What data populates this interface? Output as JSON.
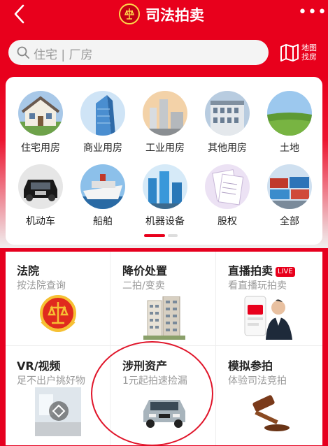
{
  "header": {
    "title": "司法拍卖",
    "back_icon": "chevron-left-icon",
    "more_label": "•••"
  },
  "search": {
    "placeholder": "住宅 | 厂房"
  },
  "map": {
    "label": "地图找房"
  },
  "categories": [
    {
      "label": "住宅用房"
    },
    {
      "label": "商业用房"
    },
    {
      "label": "工业用房"
    },
    {
      "label": "其他用房"
    },
    {
      "label": "土地"
    },
    {
      "label": "机动车"
    },
    {
      "label": "船舶"
    },
    {
      "label": "机器设备"
    },
    {
      "label": "股权"
    },
    {
      "label": "全部"
    }
  ],
  "features": [
    {
      "title": "法院",
      "subtitle": "按法院查询"
    },
    {
      "title": "降价处置",
      "subtitle": "二拍/变卖"
    },
    {
      "title": "直播拍卖",
      "badge": "LIVE",
      "subtitle": "看直播玩拍卖"
    },
    {
      "title": "VR/视频",
      "subtitle": "足不出户挑好物"
    },
    {
      "title": "涉刑资产",
      "subtitle": "1元起拍速捡漏"
    },
    {
      "title": "模拟参拍",
      "subtitle": "体验司法竞拍"
    }
  ],
  "colors": {
    "brand": "#e8001c",
    "annotation": "#e0152a"
  }
}
